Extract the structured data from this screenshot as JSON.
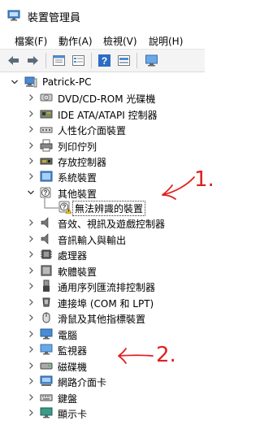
{
  "window": {
    "title": "裝置管理員"
  },
  "menu": [
    {
      "label": "檔案(F)"
    },
    {
      "label": "動作(A)"
    },
    {
      "label": "檢視(V)"
    },
    {
      "label": "說明(H)"
    }
  ],
  "toolbar": {
    "buttons": [
      {
        "icon": "back-arrow-icon"
      },
      {
        "icon": "forward-arrow-icon"
      },
      {
        "icon": "properties-icon"
      },
      {
        "icon": "device-list-icon"
      },
      {
        "icon": "help-icon"
      },
      {
        "icon": "update-driver-icon"
      },
      {
        "icon": "monitor-scan-icon"
      }
    ]
  },
  "tree": {
    "root": "Patrick-PC",
    "items": [
      {
        "label": "DVD/CD-ROM 光碟機",
        "icon": "dvd-drive-icon",
        "expanded": false
      },
      {
        "label": "IDE ATA/ATAPI 控制器",
        "icon": "ide-controller-icon",
        "expanded": false
      },
      {
        "label": "人性化介面裝置",
        "icon": "hid-icon",
        "expanded": false
      },
      {
        "label": "列印佇列",
        "icon": "printer-icon",
        "expanded": false
      },
      {
        "label": "存放控制器",
        "icon": "storage-controller-icon",
        "expanded": false
      },
      {
        "label": "系統裝置",
        "icon": "system-device-icon",
        "expanded": false
      },
      {
        "label": "其他裝置",
        "icon": "unknown-device-icon",
        "expanded": true,
        "children": [
          {
            "label": "無法辨識的裝置",
            "icon": "unknown-device-warning-icon"
          }
        ]
      },
      {
        "label": "音效、視訊及遊戲控制器",
        "icon": "speaker-icon",
        "expanded": false
      },
      {
        "label": "音訊輸入與輸出",
        "icon": "speaker-icon",
        "expanded": false
      },
      {
        "label": "處理器",
        "icon": "processor-icon",
        "expanded": false
      },
      {
        "label": "軟體裝置",
        "icon": "software-device-icon",
        "expanded": false
      },
      {
        "label": "通用序列匯流排控制器",
        "icon": "usb-controller-icon",
        "expanded": false
      },
      {
        "label": "連接埠 (COM 和 LPT)",
        "icon": "port-icon",
        "expanded": false
      },
      {
        "label": "滑鼠及其他指標裝置",
        "icon": "mouse-icon",
        "expanded": false
      },
      {
        "label": "電腦",
        "icon": "computer-icon",
        "expanded": false
      },
      {
        "label": "監視器",
        "icon": "monitor-icon",
        "expanded": false
      },
      {
        "label": "磁碟機",
        "icon": "disk-drive-icon",
        "expanded": false
      },
      {
        "label": "網路介面卡",
        "icon": "network-adapter-icon",
        "expanded": false
      },
      {
        "label": "鍵盤",
        "icon": "keyboard-icon",
        "expanded": false
      },
      {
        "label": "顯示卡",
        "icon": "display-adapter-icon",
        "expanded": false
      }
    ]
  },
  "annotations": [
    {
      "text": "1.",
      "color": "#e02020"
    },
    {
      "text": "2.",
      "color": "#e02020"
    }
  ],
  "colors": {
    "annotation": "#e02020",
    "tree_line": "#7a7a7a"
  }
}
